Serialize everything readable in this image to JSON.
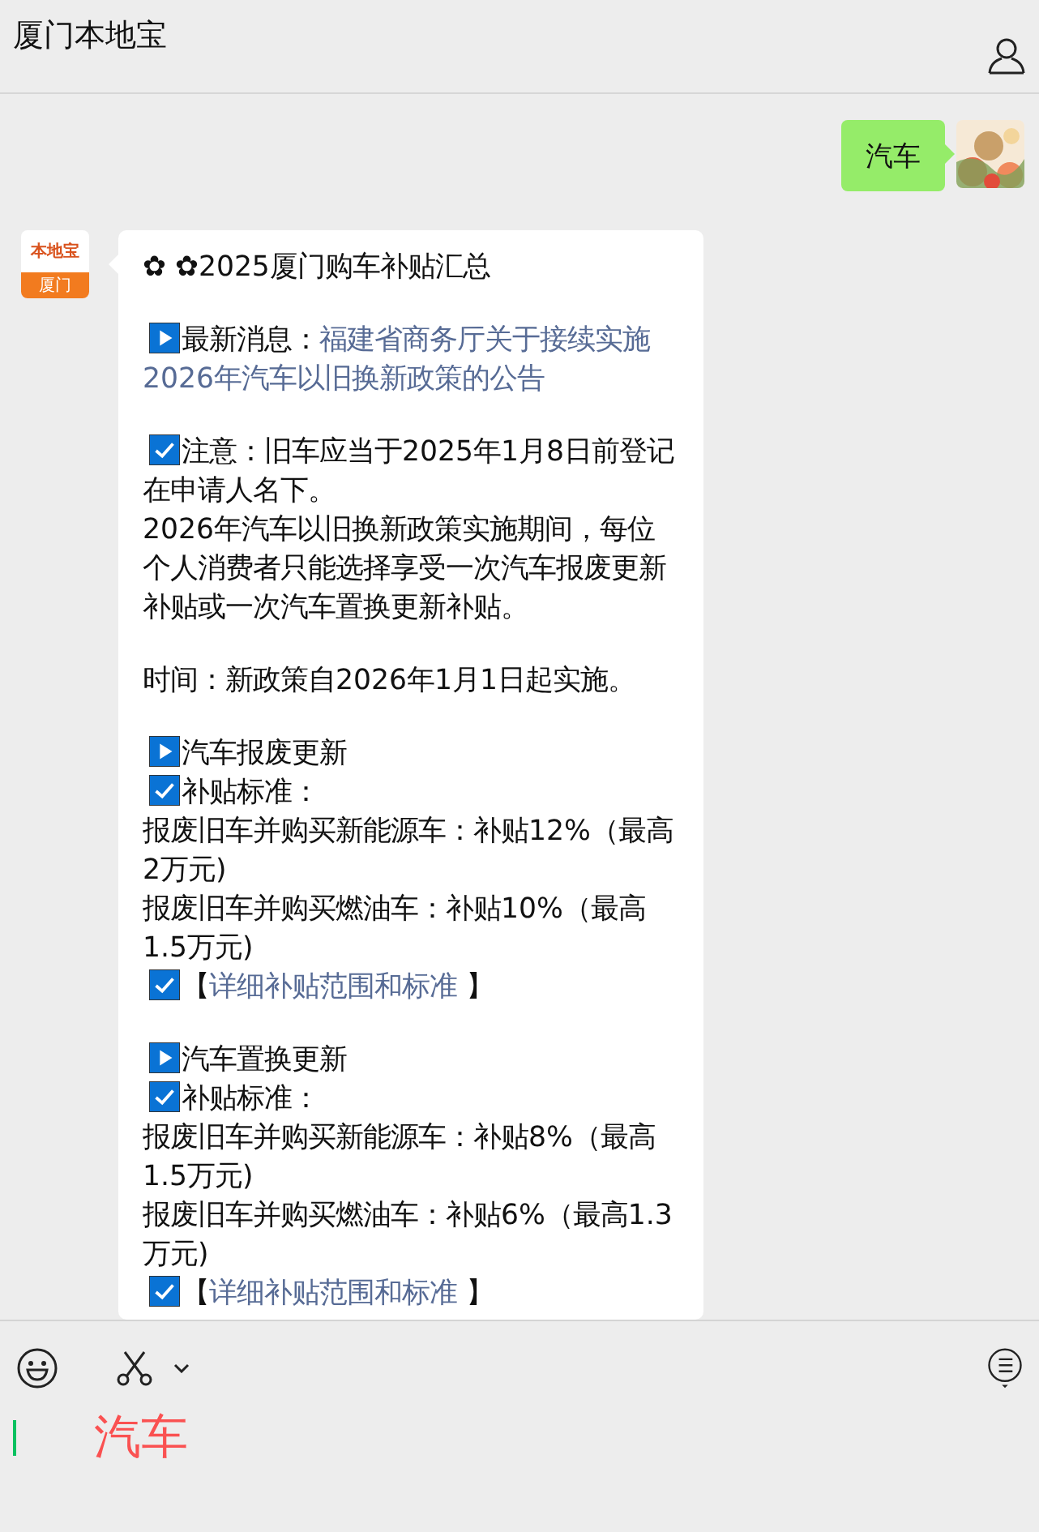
{
  "window": {
    "title": "厦门本地宝"
  },
  "messages": [
    {
      "kind": "user",
      "text": "汽车"
    },
    {
      "kind": "bot",
      "logo": {
        "top": "本地宝",
        "bottom": "厦门"
      },
      "sections": [
        [
          {
            "kind": "plain",
            "text": "✿ ✿2025厦门购车补贴汇总"
          }
        ],
        [
          {
            "kind": "play",
            "text": "最新消息：",
            "link": "福建省商务厅关于接续实施"
          },
          {
            "kind": "plain",
            "link": "2026年汽车以旧换新政策的公告"
          }
        ],
        [
          {
            "kind": "check",
            "text": "注意：旧车应当于2025年1月8日前登记"
          },
          {
            "kind": "plain",
            "text": "在申请人名下。"
          },
          {
            "kind": "plain",
            "text": "2026年汽车以旧换新政策实施期间，每位个人消费者只能选择享受一次汽车报废更新补贴或一次汽车置换更新补贴。"
          }
        ],
        [
          {
            "kind": "plain",
            "text": "时间：新政策自2026年1月1日起实施。"
          }
        ],
        [
          {
            "kind": "play",
            "text": "汽车报废更新"
          },
          {
            "kind": "check",
            "text": "补贴标准："
          },
          {
            "kind": "plain",
            "text": "报废旧车并购买新能源车：补贴12%（最高2万元)"
          },
          {
            "kind": "plain",
            "text": "报废旧车并购买燃油车：补贴10%（最高1.5万元)"
          },
          {
            "kind": "check",
            "text": "【",
            "link": "详细补贴范围和标准",
            "after": " 】"
          }
        ],
        [
          {
            "kind": "play",
            "text": "汽车置换更新"
          },
          {
            "kind": "check",
            "text": "补贴标准："
          },
          {
            "kind": "plain",
            "text": "报废旧车并购买新能源车：补贴8%（最高1.5万元)"
          },
          {
            "kind": "plain",
            "text": "报废旧车并购买燃油车：补贴6%（最高1.3万元)"
          },
          {
            "kind": "check",
            "text": "【",
            "link": "详细补贴范围和标准",
            "after": " 】"
          }
        ]
      ]
    }
  ],
  "input": {
    "value": "汽车"
  }
}
